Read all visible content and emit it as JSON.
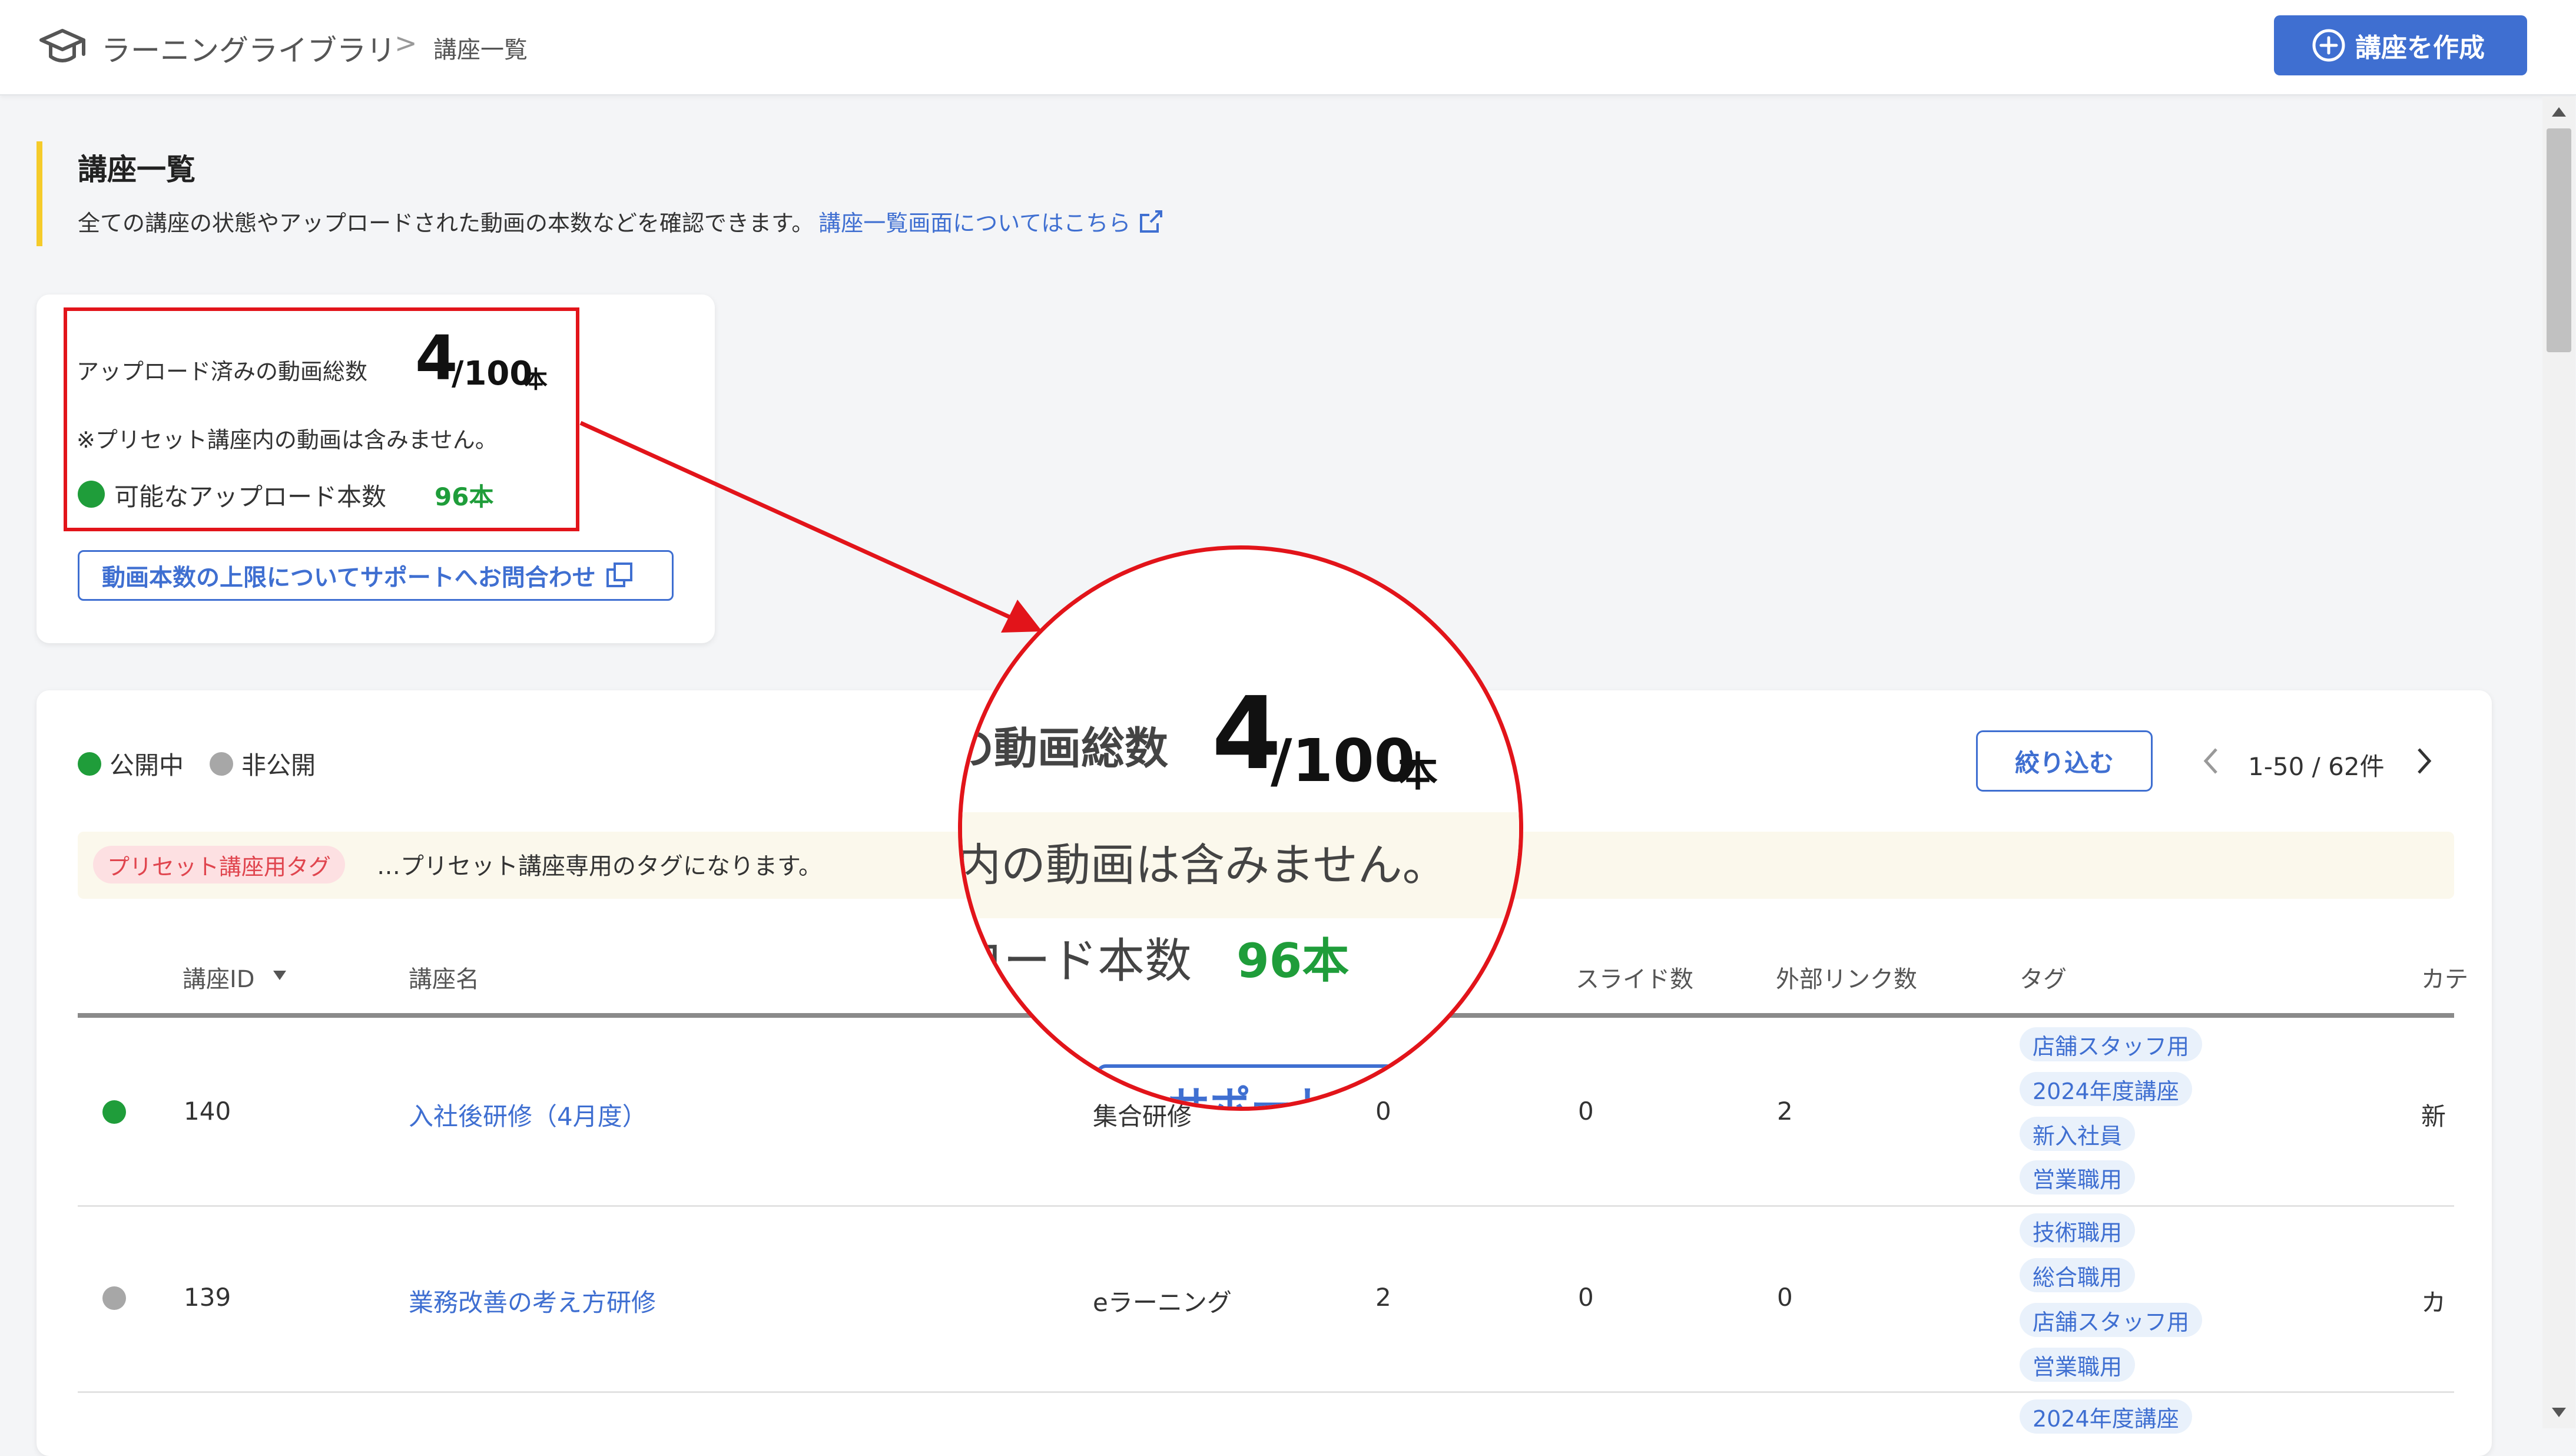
{
  "header": {
    "app_name": "ラーニングライブラリ",
    "breadcrumb_sep": ">",
    "breadcrumb_current": "講座一覧",
    "create_button": "講座を作成"
  },
  "page": {
    "title": "講座一覧",
    "description": "全ての講座の状態やアップロードされた動画の本数などを確認できます。",
    "help_link": "講座一覧画面についてはこちら"
  },
  "upload": {
    "label": "アップロード済みの動画総数",
    "count": "4",
    "total": "/100",
    "unit": "本",
    "note": "※プリセット講座内の動画は含みません。",
    "available_label": "可能なアップロード本数",
    "available_value": "96本",
    "support_button": "動画本数の上限についてサポートへお問合わせ"
  },
  "list": {
    "legend_public": "公開中",
    "legend_private": "非公開",
    "filter_button": "絞り込む",
    "pagination": "1-50 / 62件",
    "preset_tag": "プリセット講座用タグ",
    "preset_note": "…プリセット講座専用のタグになります。",
    "columns": {
      "id": "講座ID",
      "name": "講座名",
      "slides": "スライド数",
      "links": "外部リンク数",
      "tags": "タグ",
      "category": "カテ"
    },
    "rows": [
      {
        "status": "public",
        "id": "140",
        "name": "入社後研修（4月度）",
        "type": "集合研修",
        "videos": "0",
        "slides": "0",
        "links": "2",
        "tags": [
          "店舗スタッフ用",
          "2024年度講座",
          "新入社員",
          "営業職用"
        ],
        "category": "新"
      },
      {
        "status": "private",
        "id": "139",
        "name": "業務改善の考え方研修",
        "type": "eラーニング",
        "videos": "2",
        "slides": "0",
        "links": "0",
        "tags": [
          "技術職用",
          "総合職用",
          "店舗スタッフ用",
          "営業職用"
        ],
        "category": "カ"
      },
      {
        "tags": [
          "2024年度講座"
        ]
      }
    ]
  },
  "magnifier": {
    "line1": "の動画総数",
    "count": "4",
    "total": "/100",
    "unit": "本",
    "line2": "内の動画は含みません。",
    "line3": "ロード本数",
    "value": "96本",
    "button_fragment": "サポートへ"
  },
  "colors": {
    "accent": "#3f6fd1",
    "public_dot": "#1f9d3a",
    "private_dot": "#a7a7a7",
    "highlight": "#e2141a",
    "title_bar": "#f5cb2a"
  }
}
